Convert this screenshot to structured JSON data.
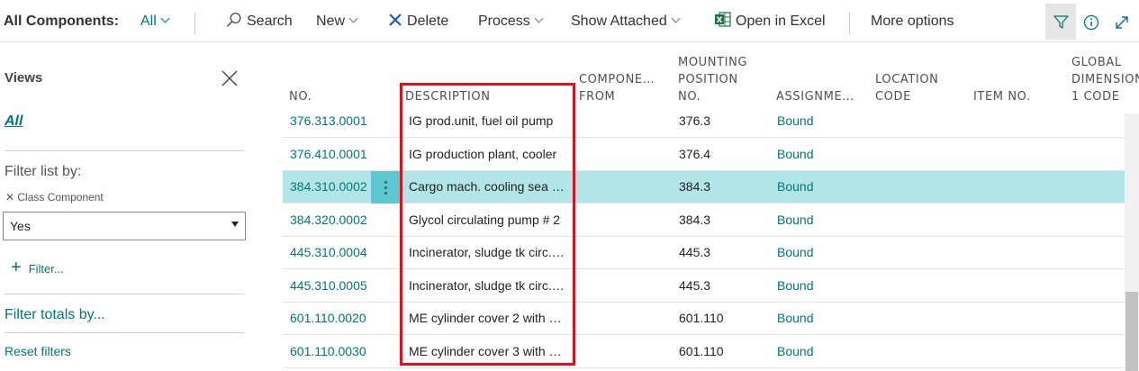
{
  "toolbar": {
    "title": "All Components:",
    "view_selector": "All",
    "search": "Search",
    "new": "New",
    "delete": "Delete",
    "process": "Process",
    "show_attached": "Show Attached",
    "open_in_excel": "Open in Excel",
    "more_options": "More options"
  },
  "filter_pane": {
    "title": "Views",
    "view_all": "All",
    "filter_list_by": "Filter list by:",
    "field_label": "Class Component",
    "field_value": "Yes",
    "add_filter": "Filter...",
    "filter_totals_by": "Filter totals by...",
    "reset_filters": "Reset filters"
  },
  "grid": {
    "headers": {
      "no": "NO.",
      "description": "DESCRIPTION",
      "component_from_1": "COMPONE…",
      "component_from_2": "FROM",
      "mounting_1": "MOUNTING",
      "mounting_2": "POSITION",
      "mounting_3": "NO.",
      "assignment": "ASSIGNME…",
      "location_1": "LOCATION",
      "location_2": "CODE",
      "item_no": "ITEM NO.",
      "global_1": "GLOBAL",
      "global_2": "DIMENSION",
      "global_3": "1 CODE"
    },
    "rows": [
      {
        "no": "376.313.0001",
        "description": "IG prod.unit, fuel oil pump",
        "position": "376.3",
        "assignment": "Bound"
      },
      {
        "no": "376.410.0001",
        "description": "IG production plant, cooler",
        "position": "376.4",
        "assignment": "Bound"
      },
      {
        "no": "384.310.0002",
        "description": "Cargo mach. cooling sea …",
        "position": "384.3",
        "assignment": "Bound"
      },
      {
        "no": "384.320.0002",
        "description": "Glycol circulating pump # 2",
        "position": "384.3",
        "assignment": "Bound"
      },
      {
        "no": "445.310.0004",
        "description": "Incinerator, sludge tk circ.…",
        "position": "445.3",
        "assignment": "Bound"
      },
      {
        "no": "445.310.0005",
        "description": "Incinerator, sludge tk circ.…",
        "position": "445.3",
        "assignment": "Bound"
      },
      {
        "no": "601.110.0020",
        "description": "ME cylinder cover 2 with …",
        "position": "601.110",
        "assignment": "Bound"
      },
      {
        "no": "601.110.0030",
        "description": "ME cylinder cover 3 with …",
        "position": "601.110",
        "assignment": "Bound"
      }
    ],
    "selected_row": 2
  },
  "colors": {
    "accent": "#00787a",
    "selected_row": "#b1e5e8",
    "highlight_box": "#e0101a"
  }
}
